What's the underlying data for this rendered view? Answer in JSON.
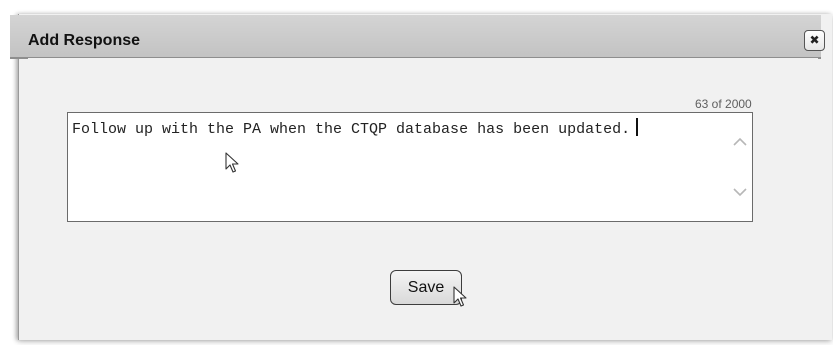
{
  "dialog": {
    "title": "Add Response",
    "close_icon": "close-x-icon",
    "close_glyph": "✖"
  },
  "response": {
    "char_count": "63 of 2000",
    "text": "Follow up with the PA when the CTQP database has been updated.",
    "scroll_up_icon": "chevron-up-icon",
    "scroll_down_icon": "chevron-down-icon"
  },
  "actions": {
    "save_label": "Save"
  },
  "cursors": {
    "pointer_in_text_icon": "mouse-pointer-icon",
    "pointer_on_save_icon": "mouse-pointer-icon"
  }
}
